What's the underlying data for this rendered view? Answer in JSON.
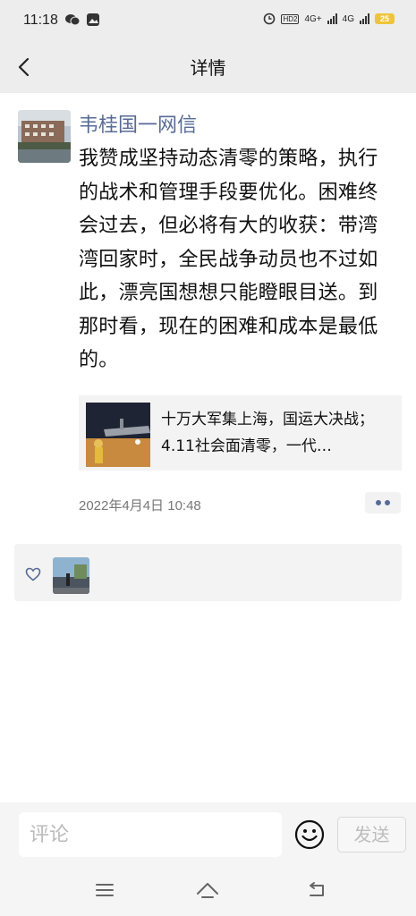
{
  "status_bar": {
    "time": "11:18",
    "network_label_1": "4G+",
    "network_label_2": "4G",
    "hd_label": "HD2",
    "battery": "25"
  },
  "nav": {
    "title": "详情"
  },
  "post": {
    "author": "韦桂国一网信",
    "text": "我赞成坚持动态清零的策略，执行的战术和管理手段要优化。困难终会过去，但必将有大的收获：带湾湾回家时，全民战争动员也不过如此，漂亮国想想只能瞪眼目送。到那时看，现在的困难和成本是最低的。",
    "link_card": {
      "title": "十万大军集上海，国运大决战；4.11社会面清零，一代…"
    },
    "timestamp": "2022年4月4日 10:48"
  },
  "comment_bar": {
    "placeholder": "评论",
    "send_label": "发送"
  },
  "colors": {
    "author_name": "#576b95",
    "background": "#ffffff",
    "bar_background": "#ededed"
  },
  "icons": {
    "back": "back-icon",
    "more": "more-dots-icon",
    "like": "heart-icon",
    "emoji": "emoji-icon",
    "menu": "menu-icon",
    "home": "home-icon",
    "return": "return-icon"
  }
}
